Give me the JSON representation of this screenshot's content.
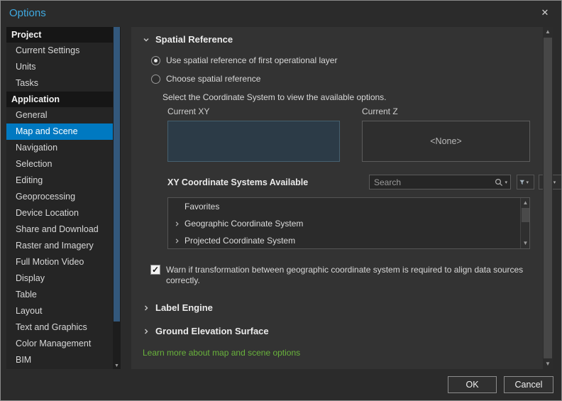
{
  "window": {
    "title": "Options"
  },
  "icons": {
    "close": "✕",
    "check": "✓",
    "up": "▲",
    "down": "▼",
    "dropdown": "▾"
  },
  "sidebar": {
    "groups": [
      {
        "header": "Project",
        "items": [
          "Current Settings",
          "Units",
          "Tasks"
        ]
      },
      {
        "header": "Application",
        "items": [
          "General",
          "Map and Scene",
          "Navigation",
          "Selection",
          "Editing",
          "Geoprocessing",
          "Device Location",
          "Share and Download",
          "Raster and Imagery",
          "Full Motion Video",
          "Display",
          "Table",
          "Layout",
          "Text and Graphics",
          "Color Management",
          "BIM"
        ]
      }
    ],
    "selected_item": "Map and Scene"
  },
  "main": {
    "spatial": {
      "title": "Spatial Reference",
      "radio_first": "Use spatial reference of first operational layer",
      "radio_choose": "Choose spatial reference",
      "instruction": "Select the Coordinate System to view the available options.",
      "current_xy_label": "Current XY",
      "current_z_label": "Current Z",
      "current_z_value": "<None>",
      "xy_available_label": "XY Coordinate Systems Available",
      "search_placeholder": "Search",
      "list": [
        "Favorites",
        "Geographic Coordinate System",
        "Projected Coordinate System"
      ],
      "warn_text": "Warn if transformation between geographic coordinate system is required to align data sources correctly."
    },
    "label_engine_title": "Label Engine",
    "ground_elevation_title": "Ground Elevation Surface",
    "learn_link": "Learn more about map and scene options"
  },
  "footer": {
    "ok": "OK",
    "cancel": "Cancel"
  },
  "colors": {
    "accent_blue": "#0079c1",
    "link_green": "#69b33c",
    "title_blue": "#3fa9e0"
  }
}
